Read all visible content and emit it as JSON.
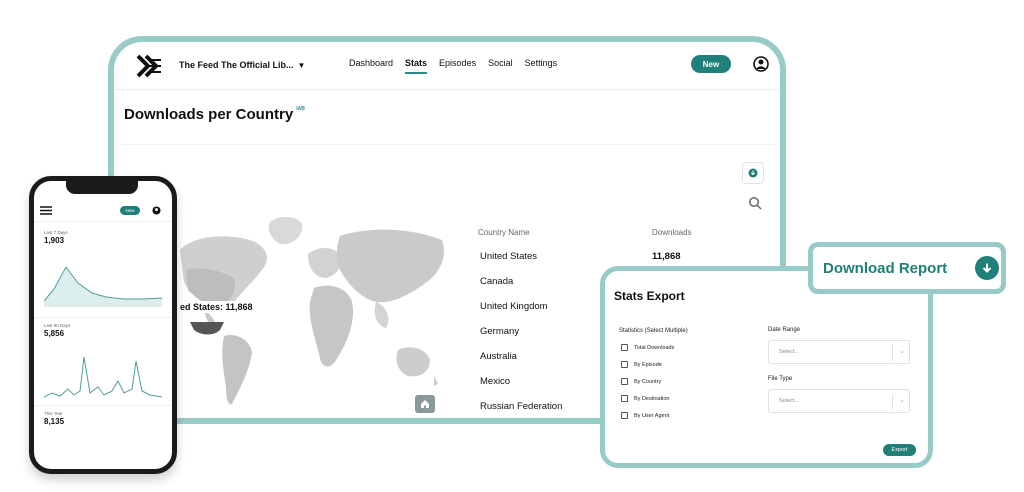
{
  "app": {
    "workspace_name": "The Feed The Official Lib...",
    "nav": [
      {
        "label": "Dashboard"
      },
      {
        "label": "Stats"
      },
      {
        "label": "Episodes"
      },
      {
        "label": "Social"
      },
      {
        "label": "Settings"
      }
    ],
    "active_nav": "Stats",
    "new_label": "New",
    "accent_color": "#1f7f79",
    "frame_color": "#98cbc7"
  },
  "page": {
    "title": "Downloads per Country",
    "badge": "IAB"
  },
  "map": {
    "tooltip": "ed States: 11,868"
  },
  "table": {
    "col_country": "Country Name",
    "col_downloads": "Downloads",
    "rows": [
      {
        "country": "United States",
        "downloads": "11,868"
      },
      {
        "country": "Canada"
      },
      {
        "country": "United Kingdom"
      },
      {
        "country": "Germany"
      },
      {
        "country": "Australia"
      },
      {
        "country": "Mexico"
      },
      {
        "country": "Russian Federation"
      }
    ]
  },
  "phone": {
    "new_label": "New",
    "cards": [
      {
        "label": "Last 7 Days",
        "value": "1,903"
      },
      {
        "label": "Last 90 Days",
        "value": "5,856"
      },
      {
        "label": "This Year",
        "value": "8,135"
      }
    ]
  },
  "export": {
    "title": "Stats Export",
    "stats_label": "Statistics (Select Multiple)",
    "options": [
      "Total Downloads",
      "By Episode",
      "By Country",
      "By Destination",
      "By User Agent"
    ],
    "date_range_label": "Date Range",
    "date_range_placeholder": "Select...",
    "file_type_label": "File Type",
    "file_type_placeholder": "Select...",
    "export_label": "Export"
  },
  "download_report": {
    "label": "Download Report",
    "icon": "arrow-down-circle-icon"
  }
}
